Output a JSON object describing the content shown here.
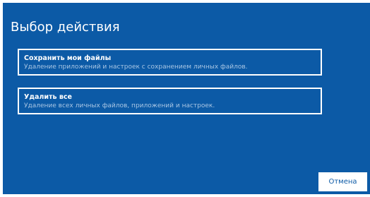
{
  "dialog": {
    "title": "Выбор действия"
  },
  "options": [
    {
      "title": "Сохранить мои файлы",
      "description": "Удаление приложений и настроек с сохранением личных файлов."
    },
    {
      "title": "Удалить все",
      "description": "Удаление всех личных файлов, приложений и настроек."
    }
  ],
  "buttons": {
    "cancel_label": "Отмена"
  },
  "colors": {
    "background": "#0c5aa6",
    "text": "#ffffff",
    "description_text": "#a9c6e4",
    "button_text": "#0c5aa6"
  }
}
